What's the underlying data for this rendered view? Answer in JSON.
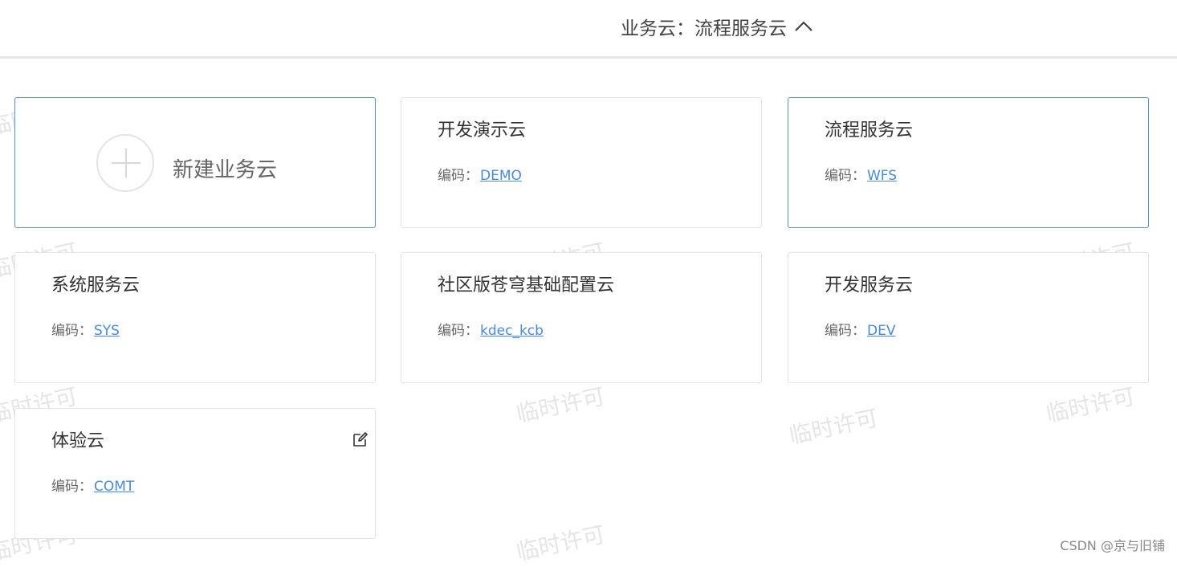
{
  "header": {
    "title": "业务云：流程服务云"
  },
  "new_card": {
    "label": "新建业务云"
  },
  "code_prefix": "编码：",
  "cards": [
    {
      "title": "开发演示云",
      "code": "DEMO"
    },
    {
      "title": "流程服务云",
      "code": "WFS",
      "selected": true
    },
    {
      "title": "系统服务云",
      "code": "SYS"
    },
    {
      "title": "社区版苍穹基础配置云",
      "code": "kdec_kcb"
    },
    {
      "title": "开发服务云",
      "code": "DEV"
    },
    {
      "title": "体验云",
      "code": "COMT"
    }
  ],
  "watermark": "临时许可",
  "footer": {
    "credit": "CSDN @京与旧铺"
  },
  "colors": {
    "accent": "#4a89dc",
    "selected_border": "#5b8fd6"
  }
}
